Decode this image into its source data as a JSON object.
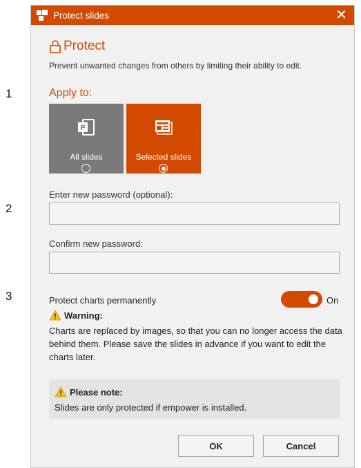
{
  "step_numbers": [
    "1",
    "2",
    "3"
  ],
  "titlebar": {
    "title": "Protect slides",
    "close_glyph": "✕",
    "app_icon": "empower-logo-icon"
  },
  "protect": {
    "heading": "Protect",
    "heading_icon": "lock-icon",
    "description": "Prevent unwanted changes from others by limiting their ability to edit."
  },
  "apply": {
    "label": "Apply to:",
    "options": [
      {
        "label": "All slides",
        "icon": "powerpoint-icon",
        "selected": false
      },
      {
        "label": "Selected slides",
        "icon": "selected-slides-icon",
        "selected": true
      }
    ]
  },
  "password": {
    "new_label": "Enter new password (optional):",
    "new_value": "",
    "confirm_label": "Confirm new password:",
    "confirm_value": ""
  },
  "charts": {
    "label": "Protect charts permanently",
    "toggle_on": true,
    "toggle_state": "On",
    "warning_title": "Warning:",
    "warning_text": "Charts are replaced by images, so that you can no longer access the data behind them. Please save the slides in advance if you want to edit the charts later."
  },
  "note": {
    "title": "Please note:",
    "text": "Slides are only protected if empower is installed."
  },
  "buttons": {
    "ok": "OK",
    "cancel": "Cancel"
  },
  "colors": {
    "accent": "#d24a00",
    "tile_unselected": "#7a7a7a",
    "warning_yellow": "#f2c21b",
    "dialog_bg": "#f1f1f1",
    "note_bg": "#e3e3e3"
  }
}
